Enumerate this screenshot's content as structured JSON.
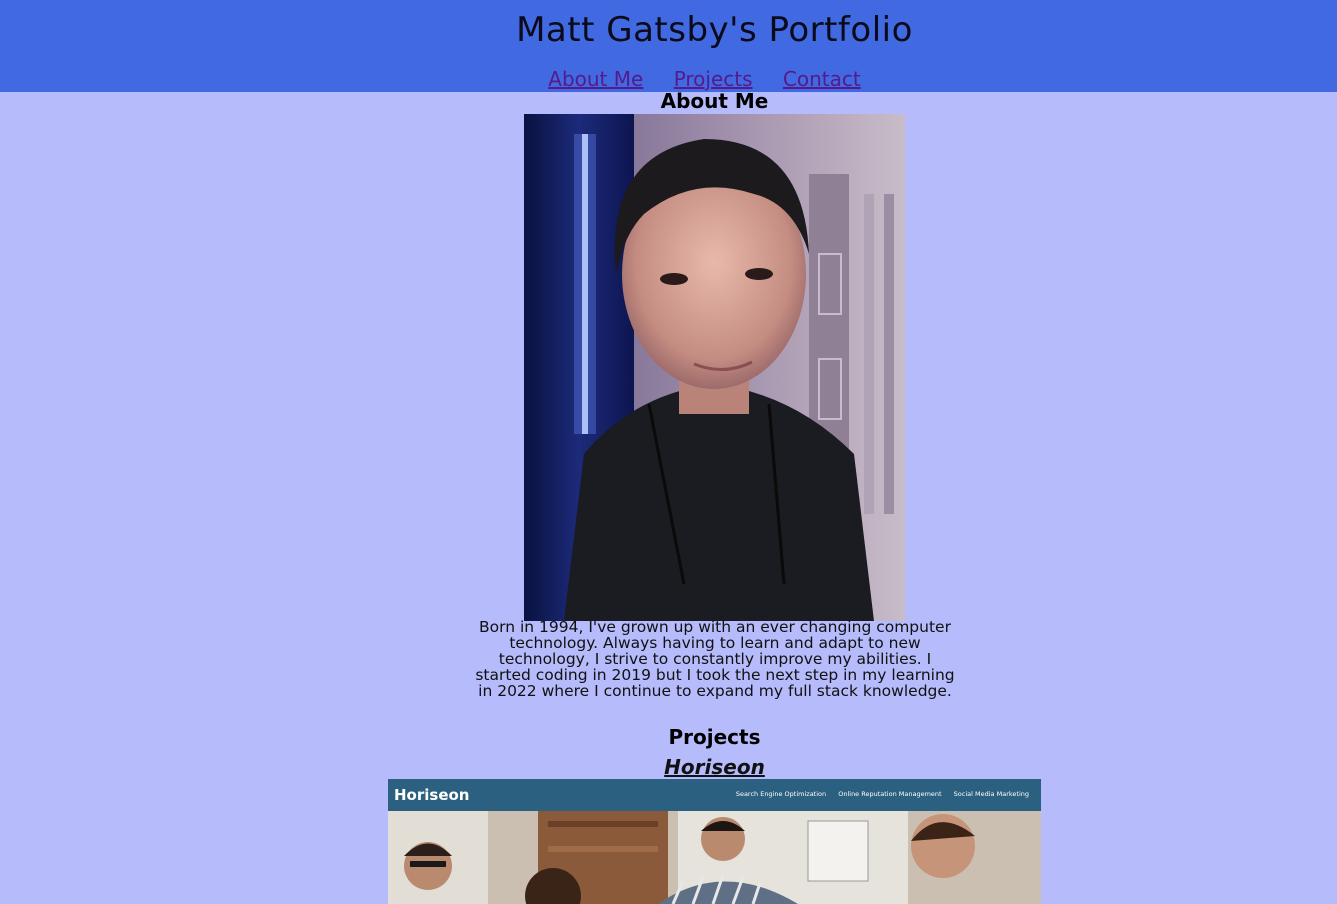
{
  "header": {
    "title": "Matt Gatsby's Portfolio",
    "background": "#4169e1"
  },
  "nav": {
    "items": [
      {
        "label": "About Me"
      },
      {
        "label": "Projects"
      },
      {
        "label": "Contact"
      }
    ],
    "link_color": "#551a8b"
  },
  "about": {
    "heading": "About Me",
    "bio": "Born in 1994, I've grown up with an ever changing computer technology. Always having to learn and adapt to new technology, I strive to constantly improve my abilities. I started coding in 2019 but I took the next step in my learning in 2022 where I continue to expand my full stack knowledge."
  },
  "projects": {
    "heading": "Projects",
    "items": [
      {
        "title": "Horiseon",
        "screenshot": {
          "logo": "Horiseon",
          "nav": [
            "Search Engine Optimization",
            "Online Reputation Management",
            "Social Media Marketing"
          ]
        }
      }
    ]
  },
  "page": {
    "background": "#b5bbfb"
  }
}
